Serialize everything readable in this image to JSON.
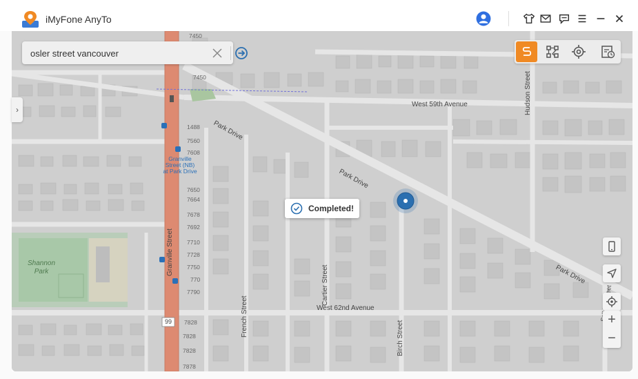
{
  "app": {
    "title": "iMyFone AnyTo"
  },
  "toolbar": {
    "icons": [
      "user-avatar-icon",
      "tshirt-icon",
      "mail-icon",
      "chat-icon",
      "menu-icon",
      "minimize-icon",
      "close-icon"
    ]
  },
  "search": {
    "value": "osler street vancouver"
  },
  "modes": {
    "items": [
      "two-spot-route-icon",
      "multi-spot-route-icon",
      "teleport-icon",
      "history-icon"
    ],
    "active": "two-spot-route-icon",
    "accent": "#f08a24"
  },
  "toast": {
    "text": "Completed!"
  },
  "map": {
    "streets": {
      "w59": "West 59th Avenue",
      "w62": "West 62nd Avenue",
      "park1": "Park Drive",
      "park2": "Park Drive",
      "park3": "Park Drive",
      "hudson": "Hudson Street",
      "granville": "Granville Street",
      "cartier": "Cartier Street",
      "french": "French Street",
      "birch": "Birch Street",
      "selkirk": "Selkirk Street"
    },
    "park": "Shannon Park",
    "transit_stop": "Granville Street (NB) at Park Drive",
    "route_shield": "99",
    "house_numbers": {
      "n1": "7450",
      "n2": "7450",
      "n3": "1488",
      "n4": "7560",
      "n5": "7608",
      "n6": "7650",
      "n7": "7664",
      "n8": "7678",
      "n9": "7692",
      "n10": "7710",
      "n11": "7728",
      "n12": "7750",
      "n13": "770",
      "n14": "7790",
      "n15": "7828",
      "n16": "7828",
      "n17": "7828",
      "n18": "7878"
    },
    "road_color": "#e28c72",
    "marker_color": "#2b6fb0"
  }
}
